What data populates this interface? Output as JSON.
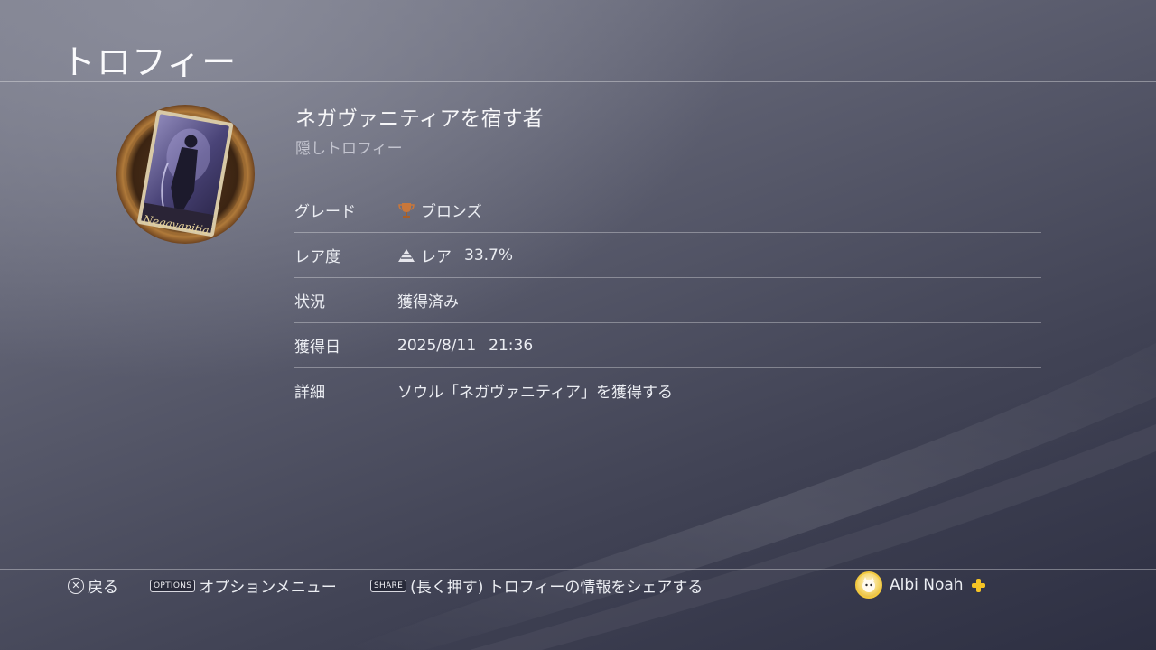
{
  "header": {
    "title": "トロフィー"
  },
  "trophy": {
    "name": "ネガヴァニティアを宿す者",
    "type_label": "隠しトロフィー",
    "icon_caption": "Negavanitia"
  },
  "details": [
    {
      "key": "グレード",
      "value": "ブロンズ",
      "icon": "bronze-trophy-icon"
    },
    {
      "key": "レア度",
      "value": "レア",
      "extra": "33.7%",
      "icon": "rarity-pyramid-icon"
    },
    {
      "key": "状況",
      "value": "獲得済み"
    },
    {
      "key": "獲得日",
      "value": "2025/8/11",
      "extra": "21:36"
    },
    {
      "key": "詳細",
      "value": "ソウル「ネガヴァニティア」を獲得する"
    }
  ],
  "footer": {
    "back_label": "戻る",
    "options_tag": "OPTIONS",
    "options_label": "オプションメニュー",
    "share_tag": "SHARE",
    "share_label": "(長く押す) トロフィーの情報をシェアする",
    "user_name": "Albi Noah"
  },
  "colors": {
    "bronze": "#c9773a",
    "plus_yellow": "#f6c425",
    "background_dark": "#2d2f42"
  }
}
